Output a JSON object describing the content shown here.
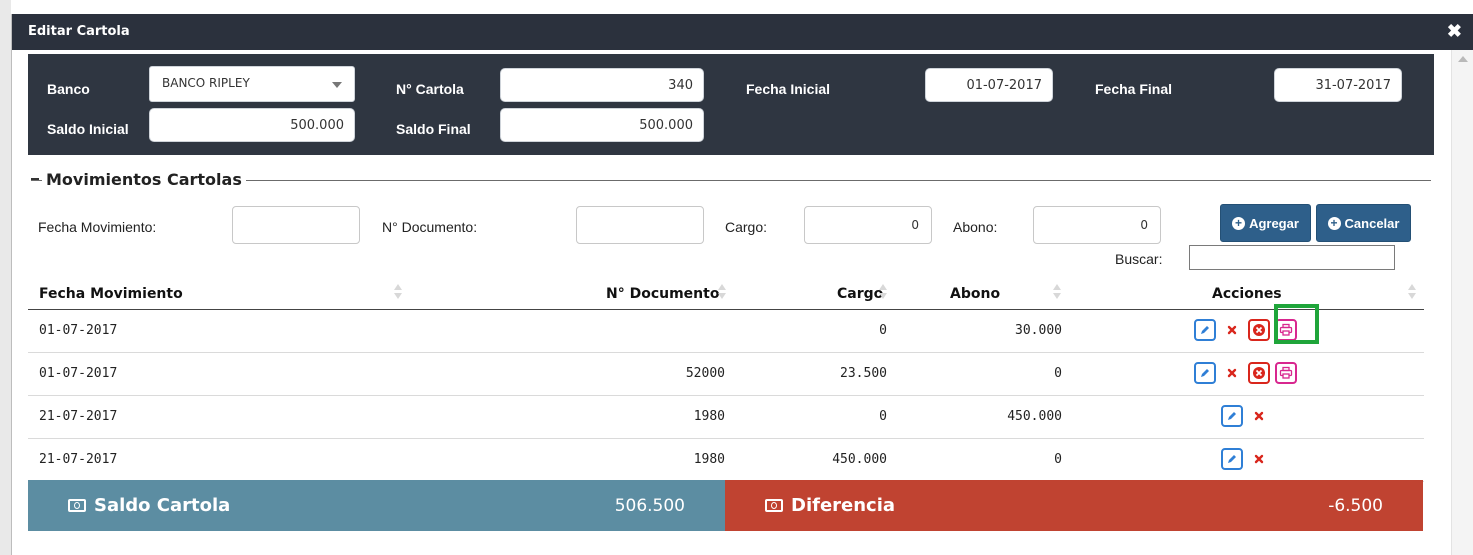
{
  "modal": {
    "title": "Editar Cartola",
    "close_glyph": "✖"
  },
  "header": {
    "banco_label": "Banco",
    "banco_value": "BANCO RIPLEY",
    "cartola_label": "N° Cartola",
    "cartola_value": "340",
    "fecha_inicial_label": "Fecha Inicial",
    "fecha_inicial_value": "01-07-2017",
    "fecha_final_label": "Fecha Final",
    "fecha_final_value": "31-07-2017",
    "saldo_inicial_label": "Saldo Inicial",
    "saldo_inicial_value": "500.000",
    "saldo_final_label": "Saldo Final",
    "saldo_final_value": "500.000"
  },
  "movimientos": {
    "section_title": "Movimientos Cartolas",
    "fecha_label": "Fecha Movimiento:",
    "fecha_value": "",
    "documento_label": "N° Documento:",
    "documento_value": "",
    "cargo_label": "Cargo:",
    "cargo_value": "0",
    "abono_label": "Abono:",
    "abono_value": "0",
    "agregar_label": "Agregar",
    "cancelar_label": "Cancelar",
    "buscar_label": "Buscar:",
    "buscar_value": ""
  },
  "table": {
    "columns": [
      "Fecha Movimiento",
      "N° Documento",
      "Cargo",
      "Abono",
      "Acciones"
    ],
    "rows": [
      {
        "fecha": "01-07-2017",
        "documento": "",
        "cargo": "0",
        "abono": "30.000",
        "actions": [
          "edit",
          "delete",
          "cancel",
          "print"
        ]
      },
      {
        "fecha": "01-07-2017",
        "documento": "52000",
        "cargo": "23.500",
        "abono": "0",
        "actions": [
          "edit",
          "delete",
          "cancel",
          "print"
        ]
      },
      {
        "fecha": "21-07-2017",
        "documento": "1980",
        "cargo": "0",
        "abono": "450.000",
        "actions": [
          "edit",
          "delete"
        ]
      },
      {
        "fecha": "21-07-2017",
        "documento": "1980",
        "cargo": "450.000",
        "abono": "0",
        "actions": [
          "edit",
          "delete"
        ]
      }
    ]
  },
  "summary": {
    "saldo_label": "Saldo Cartola",
    "saldo_value": "506.500",
    "diferencia_label": "Diferencia",
    "diferencia_value": "-6.500"
  },
  "colors": {
    "header_bg": "#2f3641",
    "titlebar_bg": "#2b313d",
    "button_bg": "#2e5f8a",
    "saldo_bg": "#5c8da2",
    "diferencia_bg": "#c04331",
    "edit_color": "#2f7fd6",
    "delete_color": "#d9261c",
    "print_color": "#d8278f",
    "highlight_color": "#1fa53a"
  }
}
